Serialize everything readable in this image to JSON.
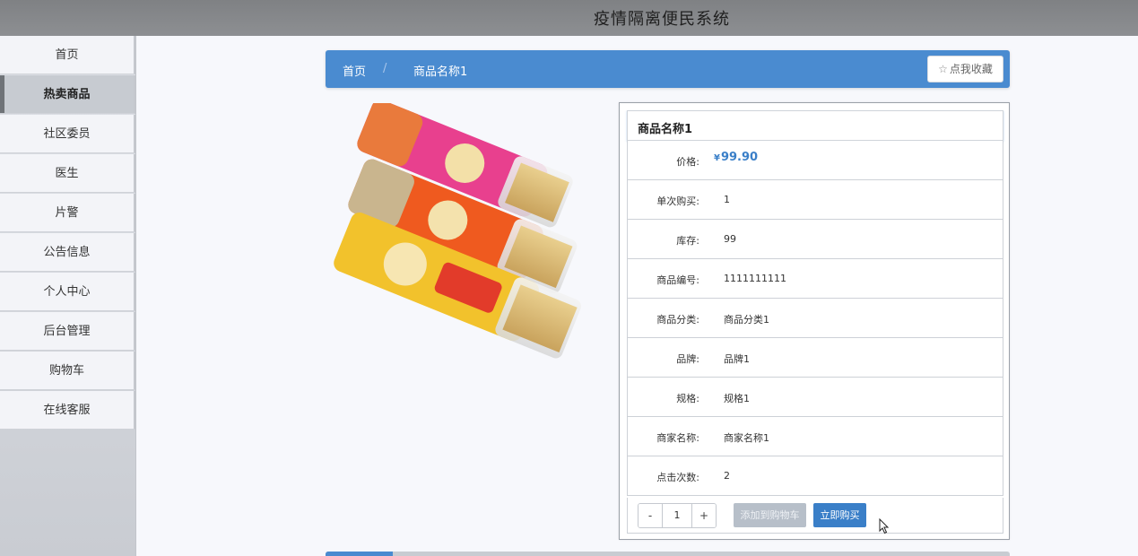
{
  "header": {
    "title": "疫情隔离便民系统"
  },
  "sidebar": {
    "items": [
      {
        "label": "首页"
      },
      {
        "label": "热卖商品"
      },
      {
        "label": "社区委员"
      },
      {
        "label": "医生"
      },
      {
        "label": "片警"
      },
      {
        "label": "公告信息"
      },
      {
        "label": "个人中心"
      },
      {
        "label": "后台管理"
      },
      {
        "label": "购物车"
      },
      {
        "label": "在线客服"
      }
    ]
  },
  "breadcrumb": {
    "home": "首页",
    "separator": "/",
    "current": "商品名称1",
    "favorite_label": "点我收藏"
  },
  "product": {
    "name": "商品名称1",
    "price_label": "价格:",
    "price_currency": "¥",
    "price_value": "99.90",
    "fields": [
      {
        "label": "单次购买:",
        "value": "1"
      },
      {
        "label": "库存:",
        "value": "99"
      },
      {
        "label": "商品编号:",
        "value": "1111111111"
      },
      {
        "label": "商品分类:",
        "value": "商品分类1"
      },
      {
        "label": "品牌:",
        "value": "品牌1"
      },
      {
        "label": "规格:",
        "value": "规格1"
      },
      {
        "label": "商家名称:",
        "value": "商家名称1"
      },
      {
        "label": "点击次数:",
        "value": "2"
      }
    ]
  },
  "actions": {
    "decrement": "-",
    "quantity": "1",
    "increment": "+",
    "add_to_cart": "添加到购物车",
    "buy_now": "立即购买"
  },
  "colors": {
    "primary": "#4a8bd0",
    "price": "#3a7fc8",
    "topbar": "#87898c"
  }
}
